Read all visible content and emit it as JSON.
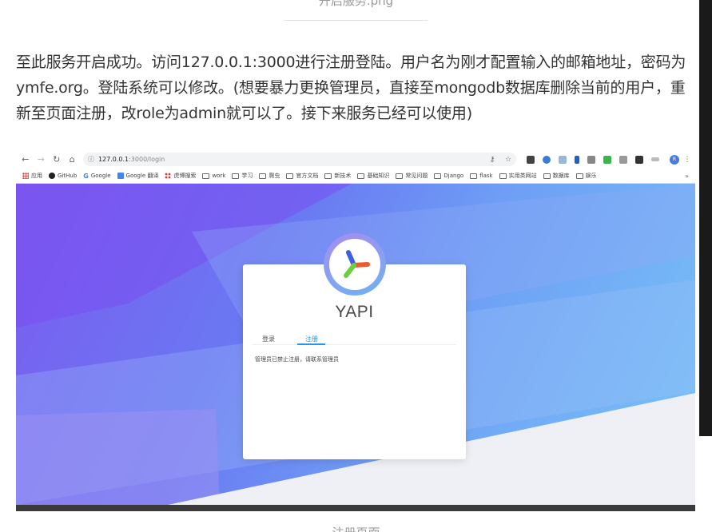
{
  "top_caption": "开启服务.png",
  "paragraph": "至此服务开启成功。访问127.0.0.1:3000进行注册登陆。用户名为刚才配置输入的邮箱地址，密码为ymfe.org。登陆系统可以修改。(想要暴力更换管理员，直接至mongodb数据库删除当前的用户，重新至页面注册，改role为admin就可以了。接下来服务已经可以使用)",
  "browser": {
    "url_host": "127.0.0.1",
    "url_path": ":3000/login",
    "avatar_text": "R",
    "bookmarks": [
      "应用",
      "GitHub",
      "Google",
      "Google 翻译",
      "虎博搜索",
      "work",
      "学习",
      "爬虫",
      "官方文档",
      "新技术",
      "基础知识",
      "常见问题",
      "Django",
      "flask",
      "实用类网站",
      "数据库",
      "娱乐"
    ],
    "more": "»"
  },
  "yapi": {
    "brand": "YAPI",
    "tab_login": "登录",
    "tab_register": "注册",
    "notice": "管理员已禁止注册，请联系管理员"
  },
  "bottom_caption": "注册页面",
  "colors": {
    "accent": "#2395f1",
    "gradient_start": "#7b5cf0",
    "gradient_end": "#78c3f6"
  },
  "icons": [
    "back-icon",
    "forward-icon",
    "reload-icon",
    "home-icon",
    "info-icon",
    "key-icon",
    "star-icon",
    "folder-icon",
    "github-icon",
    "google-icon",
    "apps-icon",
    "yapi-logo-icon"
  ]
}
